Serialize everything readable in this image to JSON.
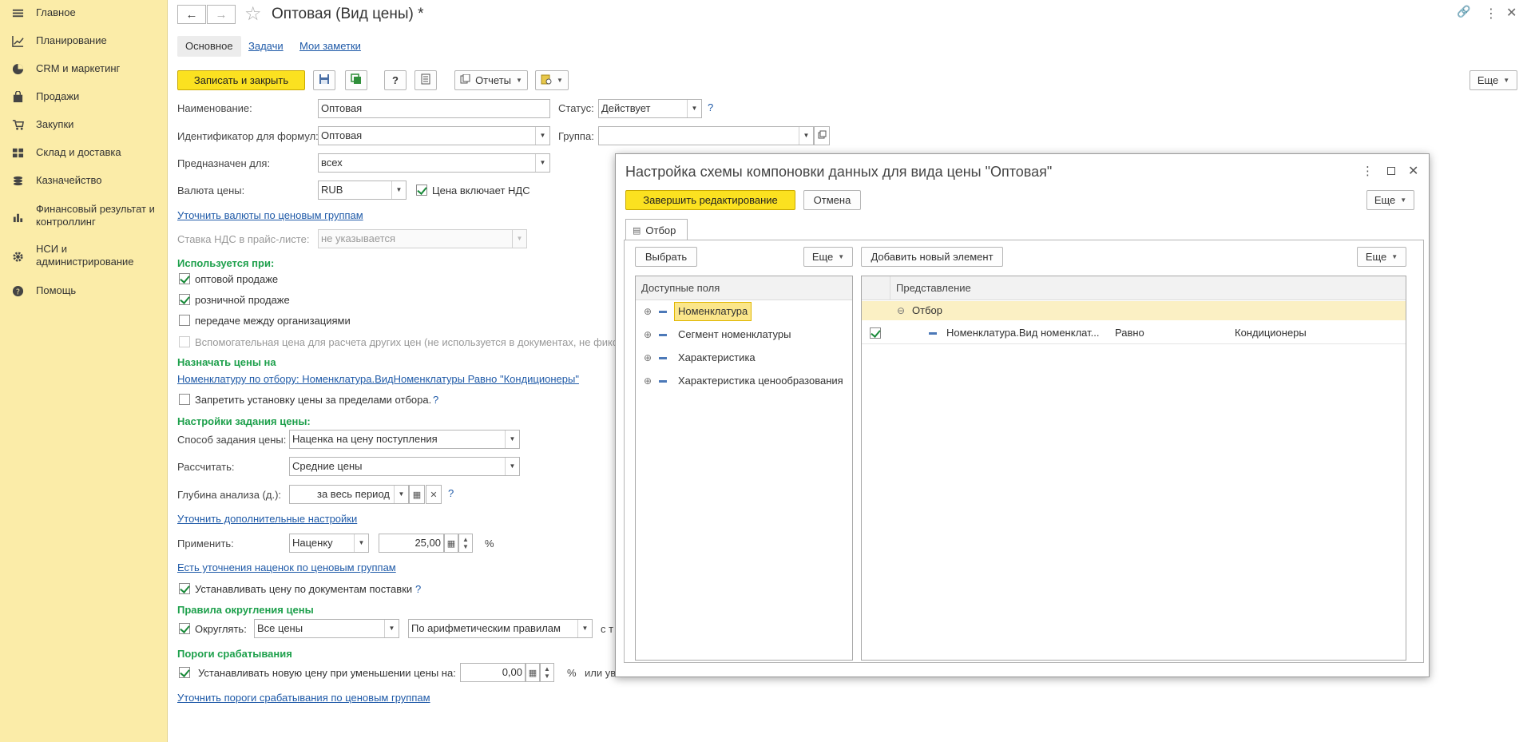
{
  "colors": {
    "accent_yellow": "#fbe120",
    "sidebar_bg": "#fbeca8",
    "section_green": "#1ea04c",
    "link_blue": "#1f5aa8"
  },
  "sidebar": {
    "items": [
      {
        "label": "Главное",
        "icon": "menu-icon"
      },
      {
        "label": "Планирование",
        "icon": "chart-trend-icon"
      },
      {
        "label": "CRM и маркетинг",
        "icon": "pie-chart-icon"
      },
      {
        "label": "Продажи",
        "icon": "bag-icon"
      },
      {
        "label": "Закупки",
        "icon": "cart-icon"
      },
      {
        "label": "Склад и доставка",
        "icon": "grid-icon"
      },
      {
        "label": "Казначейство",
        "icon": "coins-icon"
      },
      {
        "label": "Финансовый результат и контроллинг",
        "icon": "bar-chart-icon"
      },
      {
        "label": "НСИ и администрирование",
        "icon": "gear-icon"
      },
      {
        "label": "Помощь",
        "icon": "help-icon"
      }
    ]
  },
  "header": {
    "title": "Оптовая (Вид цены) *",
    "back": "←",
    "forward": "→",
    "star": "☆",
    "link_icon": "🔗",
    "more_icon": "⋮",
    "close": "✕",
    "tabs": [
      "Основное",
      "Задачи",
      "Мои заметки"
    ]
  },
  "toolbar": {
    "save_close": "Записать и закрыть",
    "help": "?",
    "reports": "Отчеты",
    "more": "Еще"
  },
  "form": {
    "name_label": "Наименование:",
    "name_value": "Оптовая",
    "status_label": "Статус:",
    "status_value": "Действует",
    "status_help": "?",
    "formula_id_label": "Идентификатор для формул:",
    "formula_id_value": "Оптовая",
    "group_label": "Группа:",
    "group_value": "",
    "intended_label": "Предназначен для:",
    "intended_value": "всех",
    "currency_label": "Валюта цены:",
    "currency_value": "RUB",
    "vat_included_label": "Цена включает НДС",
    "currency_groups_link": "Уточнить валюты по ценовым группам",
    "vat_rate_label": "Ставка НДС в прайс-листе:",
    "vat_rate_value": "не указывается",
    "used_section": "Используется при:",
    "wholesale": "оптовой продаже",
    "retail": "розничной продаже",
    "intercompany": "передаче между организациями",
    "auxiliary": "Вспомогательная цена для расчета других цен (не используется в документах, не фикс",
    "assign_section": "Назначать цены на",
    "assign_link": "Номенклатуру по отбору: Номенклатура.ВидНоменклатуры Равно \"Кондиционеры\"",
    "forbid_outside": "Запретить установку цены за пределами отбора.",
    "forbid_help": "?",
    "settings_section": "Настройки задания цены:",
    "method_label": "Способ задания цены:",
    "method_value": "Наценка на цену поступления",
    "calc_label": "Рассчитать:",
    "calc_value": "Средние цены",
    "depth_label": "Глубина анализа (д.):",
    "depth_value": "за весь период",
    "depth_help": "?",
    "extra_settings_link": "Уточнить дополнительные настройки",
    "apply_label": "Применить:",
    "apply_value": "Наценку",
    "apply_amount": "25,00",
    "percent": "%",
    "markup_groups_link": "Есть уточнения наценок по ценовым группам",
    "set_by_docs": "Устанавливать цену по документам поставки",
    "set_by_docs_help": "?",
    "rounding_section": "Правила округления цены",
    "round_label": "Округлять:",
    "round_value": "Все цены",
    "round_rule": "По арифметическим правилам",
    "round_tail": "с т",
    "thresholds_section": "Пороги срабатывания",
    "decrease_label": "Устанавливать новую цену при уменьшении цены на:",
    "decrease_value": "0,00",
    "decrease_pct": "%",
    "or_tail": "или ув",
    "thresholds_link": "Уточнить пороги срабатывания по ценовым группам"
  },
  "modal": {
    "title": "Настройка схемы компоновки данных для вида цены \"Оптовая\"",
    "finish": "Завершить редактирование",
    "cancel": "Отмена",
    "more": "Еще",
    "tab": "Отбор",
    "select": "Выбрать",
    "add_element": "Добавить новый элемент",
    "fields_header": "Доступные поля",
    "fields": [
      "Номенклатура",
      "Сегмент номенклатуры",
      "Характеристика",
      "Характеристика ценообразования"
    ],
    "repr_header": "Представление",
    "group_label": "Отбор",
    "condition": {
      "field": "Номенклатура.Вид номенклат...",
      "op": "Равно",
      "value": "Кондиционеры"
    }
  }
}
